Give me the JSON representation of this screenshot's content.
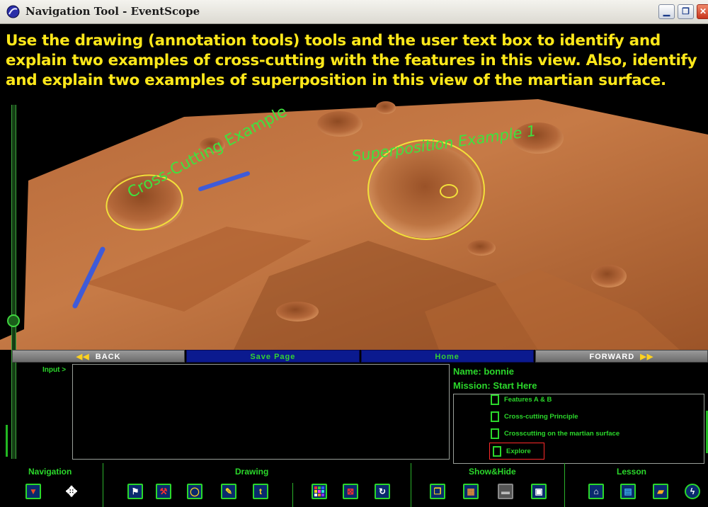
{
  "window": {
    "title": "Navigation Tool - EventScope"
  },
  "instructions": "Use the drawing (annotation tools) tools and the user text box to identify and explain two examples of cross-cutting with the features in this view. Also, identify and explain two examples of superposition in this view of the martian surface.",
  "annotations": {
    "cross_cutting": "Cross-Cutting Example",
    "superposition": "Superposition Example 1"
  },
  "nav": {
    "back": "BACK",
    "save": "Save Page",
    "home": "Home",
    "forward": "FORWARD"
  },
  "input": {
    "label": "Input >",
    "value": ""
  },
  "user": {
    "name": "Name: bonnie",
    "mission": "Mission: Start Here"
  },
  "lesson_items": [
    {
      "label": "Features A & B"
    },
    {
      "label": "Cross-cutting Principle"
    },
    {
      "label": "Crosscutting on the martian surface"
    },
    {
      "label": "Explore"
    }
  ],
  "toolbar": {
    "groups": [
      "Navigation",
      "Drawing",
      "Show&Hide",
      "Lesson"
    ],
    "tools": [
      {
        "icon": "down-arrow-icon",
        "color": "#e84a2a"
      },
      {
        "icon": "move-arrows-icon",
        "color": "#ffffff"
      },
      {
        "icon": "flag-icon",
        "color": "#ffffff"
      },
      {
        "icon": "hammer-icon",
        "color": "#ff3030"
      },
      {
        "icon": "lasso-icon",
        "color": "#ffd21e"
      },
      {
        "icon": "pencil-icon",
        "color": "#ffd21e"
      },
      {
        "icon": "text-tool-icon",
        "color": "#ffd21e"
      },
      {
        "icon": "color-palette-icon",
        "color": "#ff3030"
      },
      {
        "icon": "delete-icon",
        "color": "#ff3030"
      },
      {
        "icon": "redo-icon",
        "color": "#ffffff"
      },
      {
        "icon": "layers-icon",
        "color": "#ffd21e"
      },
      {
        "icon": "map-icon",
        "color": "#d88a3a"
      },
      {
        "icon": "screen-icon",
        "color": "#bbbbbb"
      },
      {
        "icon": "save-disk-icon",
        "color": "#ffffff"
      },
      {
        "icon": "home-icon",
        "color": "#ffffff"
      },
      {
        "icon": "floppy-icon",
        "color": "#3aa8e8"
      },
      {
        "icon": "folder-icon",
        "color": "#ffb020"
      },
      {
        "icon": "lightning-icon",
        "color": "#ffffff"
      }
    ]
  }
}
